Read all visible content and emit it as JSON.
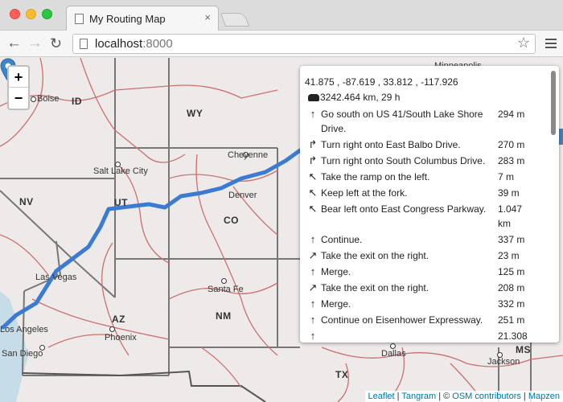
{
  "browser": {
    "tab_title": "My Routing Map",
    "tab_close": "×",
    "url_host": "localhost",
    "url_port": ":8000",
    "star": "☆",
    "back": "←",
    "forward": "→",
    "reload": "↻"
  },
  "map": {
    "zoom_in": "+",
    "zoom_out": "−",
    "states": [
      "ID",
      "WY",
      "NV",
      "UT",
      "CO",
      "AZ",
      "NM",
      "TX",
      "MS"
    ],
    "cities": [
      "Boise",
      "Salt Lake City",
      "Cheyenne",
      "Denver",
      "Las Vegas",
      "Santa Fe",
      "Phoenix",
      "San Diego",
      "Los Angeles",
      "Dallas",
      "Jackson",
      "Minneapolis"
    ],
    "route_color": "#3b7bd4",
    "attribution": {
      "leaflet": "Leaflet",
      "sep1": " | ",
      "tangram": "Tangram",
      "sep2": " | © ",
      "osm": "OSM contributors",
      "sep3": " | ",
      "mapzen": "Mapzen"
    }
  },
  "routing": {
    "coords": "41.875 , -87.619 , 33.812 , -117.926",
    "summary": "3242.464 km, 29 h",
    "steps": [
      {
        "icon": "↑",
        "text": "Go south on US 41/South Lake Shore Drive.",
        "dist": "294 m"
      },
      {
        "icon": "↱",
        "text": "Turn right onto East Balbo Drive.",
        "dist": "270 m"
      },
      {
        "icon": "↱",
        "text": "Turn right onto South Columbus Drive.",
        "dist": "283 m"
      },
      {
        "icon": "↖",
        "text": "Take the ramp on the left.",
        "dist": "7 m"
      },
      {
        "icon": "↖",
        "text": "Keep left at the fork.",
        "dist": "39 m"
      },
      {
        "icon": "↖",
        "text": "Bear left onto East Congress Parkway.",
        "dist": "1.047 km"
      },
      {
        "icon": "↑",
        "text": "Continue.",
        "dist": "337 m"
      },
      {
        "icon": "↗",
        "text": "Take the exit on the right.",
        "dist": "23 m"
      },
      {
        "icon": "↑",
        "text": "Merge.",
        "dist": "125 m"
      },
      {
        "icon": "↗",
        "text": "Take the exit on the right.",
        "dist": "208 m"
      },
      {
        "icon": "↑",
        "text": "Merge.",
        "dist": "332 m"
      },
      {
        "icon": "↑",
        "text": "Continue on Eisenhower Expressway.",
        "dist": "251 m"
      },
      {
        "icon": "↑",
        "text": "",
        "dist": "21.308"
      }
    ]
  }
}
